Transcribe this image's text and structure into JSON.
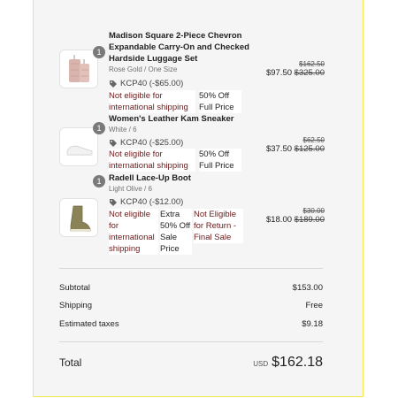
{
  "items": [
    {
      "qty": "1",
      "title": "Madison Square 2-Piece Chevron Expandable Carry-On and Checked Hardside Luggage Set",
      "variant": "Rose Gold / One Size",
      "discount": "KCP40 (-$65.00)",
      "warnings": [
        "Not eligible for international shipping"
      ],
      "notes": [
        "50% Off Full Price"
      ],
      "original_price": "$162.50",
      "price": "$97.50",
      "compare_price": "$325.00",
      "thumb_icon": "luggage-image"
    },
    {
      "qty": "1",
      "title": "Women's Leather Kam Sneaker",
      "variant": "White / 6",
      "discount": "KCP40 (-$25.00)",
      "warnings": [
        "Not eligible for international shipping"
      ],
      "notes": [
        "50% Off Full Price"
      ],
      "original_price": "$62.50",
      "price": "$37.50",
      "compare_price": "$125.00",
      "thumb_icon": "sneaker-image"
    },
    {
      "qty": "1",
      "title": "Radell Lace-Up Boot",
      "variant": "Light Olive / 6",
      "discount": "KCP40 (-$12.00)",
      "warnings": [
        "Not eligible for international shipping"
      ],
      "notes": [
        "Extra 50% Off Sale Price"
      ],
      "return_note": "Not Eligible for Return - Final Sale",
      "original_price": "$30.00",
      "price": "$18.00",
      "compare_price": "$189.00",
      "thumb_icon": "boot-image"
    }
  ],
  "summary": {
    "subtotal_label": "Subtotal",
    "subtotal": "$153.00",
    "shipping_label": "Shipping",
    "shipping": "Free",
    "taxes_label": "Estimated taxes",
    "taxes": "$9.18",
    "total_label": "Total",
    "currency": "USD",
    "total": "$162.18"
  }
}
